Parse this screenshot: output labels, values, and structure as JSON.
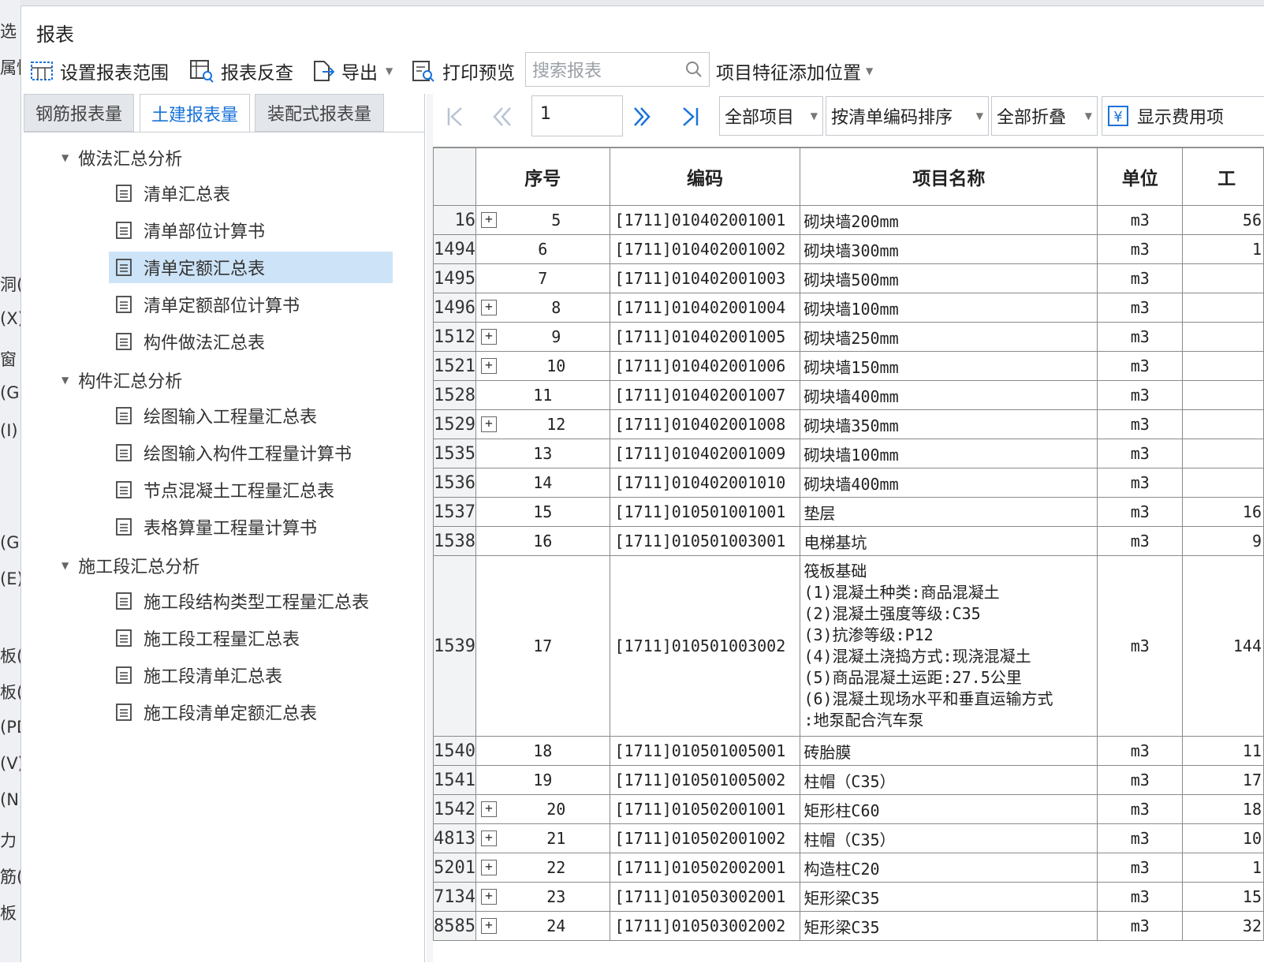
{
  "window": {
    "title": "报表"
  },
  "background_strip": [
    "选",
    "属性",
    "洞(",
    "(X)",
    "窗",
    "(G)",
    "(I)",
    "(G)",
    "(E)",
    "板(",
    "板(",
    "(PD",
    "(V)",
    "(N)",
    "力",
    "筋(",
    "板"
  ],
  "toolbar": {
    "set_range": "设置报表范围",
    "reverse_check": "报表反查",
    "export": "导出",
    "print_preview": "打印预览",
    "search_placeholder": "搜索报表",
    "feature_position": "项目特征添加位置"
  },
  "tabs": [
    {
      "label": "钢筋报表量",
      "active": false
    },
    {
      "label": "土建报表量",
      "active": true
    },
    {
      "label": "装配式报表量",
      "active": false
    }
  ],
  "tree": {
    "groups": [
      {
        "label": "做法汇总分析",
        "items": [
          "清单汇总表",
          "清单部位计算书",
          "清单定额汇总表",
          "清单定额部位计算书",
          "构件做法汇总表"
        ]
      },
      {
        "label": "构件汇总分析",
        "items": [
          "绘图输入工程量汇总表",
          "绘图输入构件工程量计算书",
          "节点混凝土工程量汇总表",
          "表格算量工程量计算书"
        ]
      },
      {
        "label": "施工段汇总分析",
        "items": [
          "施工段结构类型工程量汇总表",
          "施工段工程量汇总表",
          "施工段清单汇总表",
          "施工段清单定额汇总表"
        ]
      }
    ],
    "selected": "清单定额汇总表"
  },
  "navigation": {
    "page": "1",
    "filter": "全部项目",
    "sort": "按清单编码排序",
    "fold": "全部折叠",
    "show_fee": "显示费用项"
  },
  "table": {
    "headers": {
      "seq": "序号",
      "code": "编码",
      "name": "项目名称",
      "unit": "单位",
      "qty": "工"
    },
    "rows": [
      {
        "rownum": "16",
        "expand": true,
        "seq": "5",
        "code": "[1711]010402001001",
        "name": [
          "砌块墙200mm"
        ],
        "unit": "m3",
        "qty": "56"
      },
      {
        "rownum": "1494",
        "expand": false,
        "seq": "6",
        "code": "[1711]010402001002",
        "name": [
          "砌块墙300mm"
        ],
        "unit": "m3",
        "qty": "1"
      },
      {
        "rownum": "1495",
        "expand": false,
        "seq": "7",
        "code": "[1711]010402001003",
        "name": [
          "砌块墙500mm"
        ],
        "unit": "m3",
        "qty": ""
      },
      {
        "rownum": "1496",
        "expand": true,
        "seq": "8",
        "code": "[1711]010402001004",
        "name": [
          "砌块墙100mm"
        ],
        "unit": "m3",
        "qty": ""
      },
      {
        "rownum": "1512",
        "expand": true,
        "seq": "9",
        "code": "[1711]010402001005",
        "name": [
          "砌块墙250mm"
        ],
        "unit": "m3",
        "qty": ""
      },
      {
        "rownum": "1521",
        "expand": true,
        "seq": "10",
        "code": "[1711]010402001006",
        "name": [
          "砌块墙150mm"
        ],
        "unit": "m3",
        "qty": ""
      },
      {
        "rownum": "1528",
        "expand": false,
        "seq": "11",
        "code": "[1711]010402001007",
        "name": [
          "砌块墙400mm"
        ],
        "unit": "m3",
        "qty": ""
      },
      {
        "rownum": "1529",
        "expand": true,
        "seq": "12",
        "code": "[1711]010402001008",
        "name": [
          "砌块墙350mm"
        ],
        "unit": "m3",
        "qty": ""
      },
      {
        "rownum": "1535",
        "expand": false,
        "seq": "13",
        "code": "[1711]010402001009",
        "name": [
          "砌块墙100mm"
        ],
        "unit": "m3",
        "qty": ""
      },
      {
        "rownum": "1536",
        "expand": false,
        "seq": "14",
        "code": "[1711]010402001010",
        "name": [
          "砌块墙400mm"
        ],
        "unit": "m3",
        "qty": ""
      },
      {
        "rownum": "1537",
        "expand": false,
        "seq": "15",
        "code": "[1711]010501001001",
        "name": [
          "垫层"
        ],
        "unit": "m3",
        "qty": "16"
      },
      {
        "rownum": "1538",
        "expand": false,
        "seq": "16",
        "code": "[1711]010501003001",
        "name": [
          "电梯基坑"
        ],
        "unit": "m3",
        "qty": "9"
      },
      {
        "rownum": "1539",
        "expand": false,
        "seq": "17",
        "code": "[1711]010501003002",
        "name": [
          "筏板基础",
          "(1)混凝土种类:商品混凝土",
          "(2)混凝土强度等级:C35",
          "(3)抗渗等级:P12",
          "(4)混凝土浇捣方式:现浇混凝土",
          "(5)商品混凝土运距:27.5公里",
          "(6)混凝土现场水平和垂直运输方式",
          ":地泵配合汽车泵"
        ],
        "unit": "m3",
        "qty": "144"
      },
      {
        "rownum": "1540",
        "expand": false,
        "seq": "18",
        "code": "[1711]010501005001",
        "name": [
          "砖胎膜"
        ],
        "unit": "m3",
        "qty": "11"
      },
      {
        "rownum": "1541",
        "expand": false,
        "seq": "19",
        "code": "[1711]010501005002",
        "name": [
          "柱帽（C35）"
        ],
        "unit": "m3",
        "qty": "17"
      },
      {
        "rownum": "1542",
        "expand": true,
        "seq": "20",
        "code": "[1711]010502001001",
        "name": [
          "矩形柱C60"
        ],
        "unit": "m3",
        "qty": "18"
      },
      {
        "rownum": "4813",
        "expand": true,
        "seq": "21",
        "code": "[1711]010502001002",
        "name": [
          "柱帽（C35）"
        ],
        "unit": "m3",
        "qty": "10"
      },
      {
        "rownum": "5201",
        "expand": true,
        "seq": "22",
        "code": "[1711]010502002001",
        "name": [
          "构造柱C20"
        ],
        "unit": "m3",
        "qty": "1"
      },
      {
        "rownum": "7134",
        "expand": true,
        "seq": "23",
        "code": "[1711]010503002001",
        "name": [
          "矩形梁C35"
        ],
        "unit": "m3",
        "qty": "15"
      },
      {
        "rownum": "8585",
        "expand": true,
        "seq": "24",
        "code": "[1711]010503002002",
        "name": [
          "矩形梁C35"
        ],
        "unit": "m3",
        "qty": "32"
      }
    ]
  }
}
